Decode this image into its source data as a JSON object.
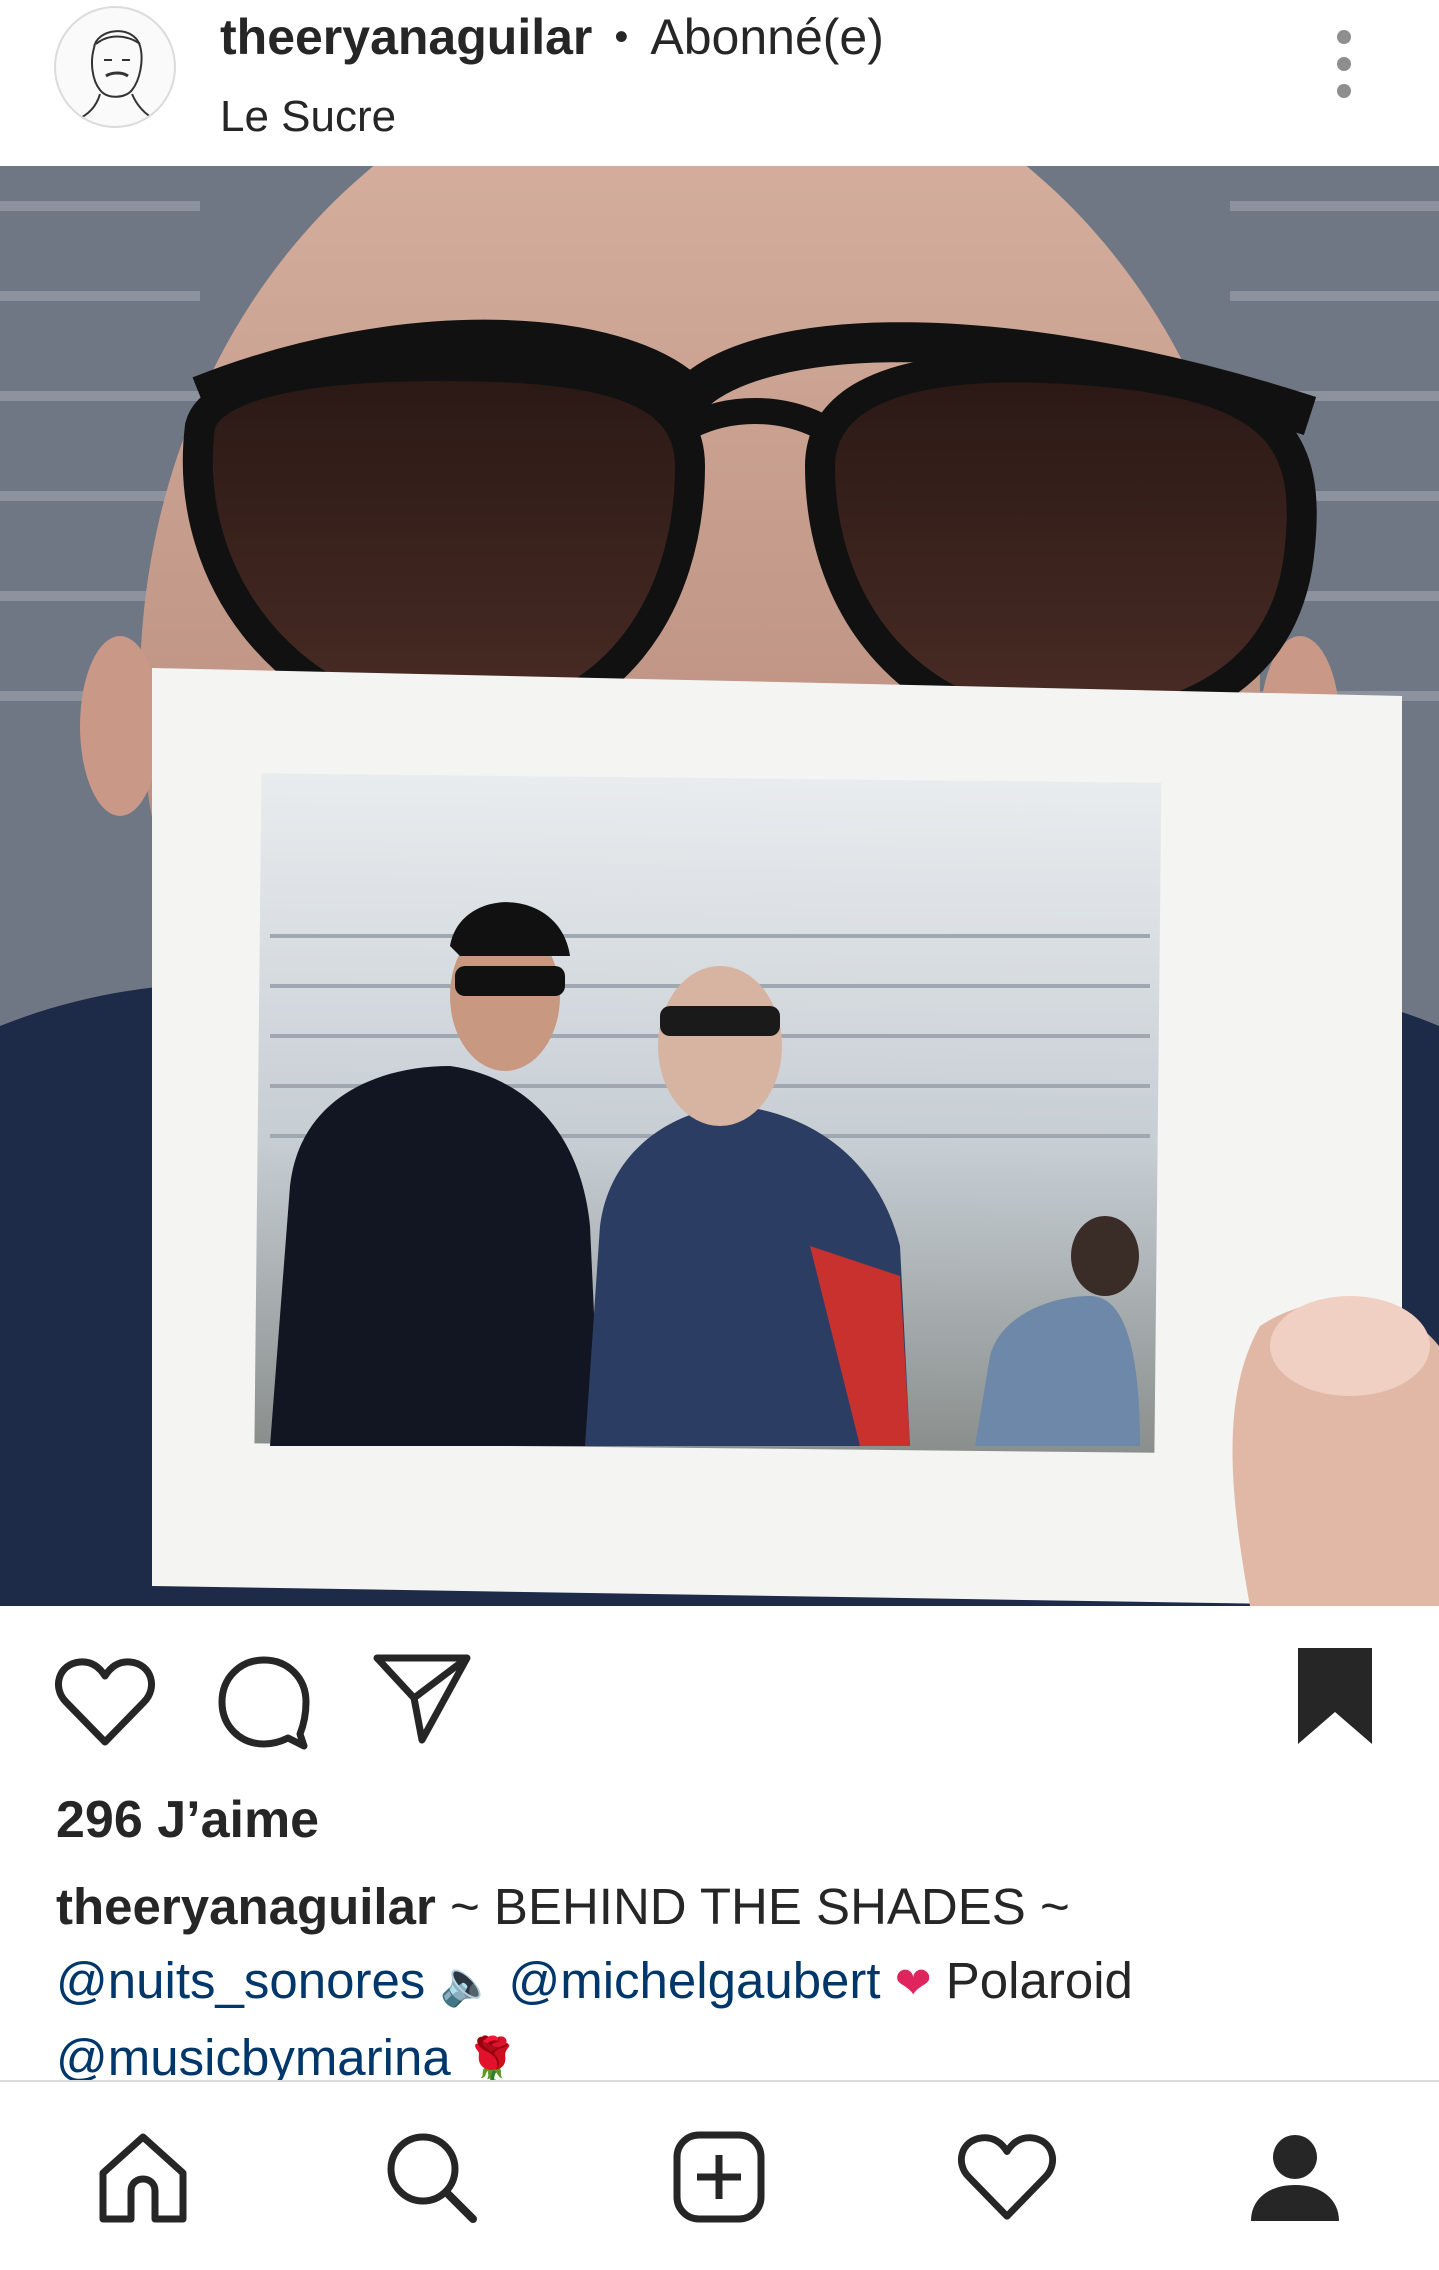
{
  "post": {
    "header": {
      "username": "theeryanaguilar",
      "separator": "•",
      "follow_status": "Abonné(e)",
      "location": "Le Sucre"
    },
    "likes_text": "296 J’aime",
    "caption": {
      "username": "theeryanaguilar",
      "text_line1": " ~ BEHIND THE SHADES ~",
      "mention1": "@nuits_sonores",
      "emoji1": "🔈",
      "mention2": "@michelgaubert",
      "emoji2": "❤",
      "text_polaroid": " Polaroid",
      "mention3": "@musicbymarina",
      "emoji3": "🌹"
    },
    "actions": {
      "like_icon": "heart-outline-icon",
      "comment_icon": "comment-bubble-icon",
      "share_icon": "paper-plane-icon",
      "save_icon": "bookmark-filled-icon"
    }
  },
  "bottom_nav": {
    "items": [
      "home-icon",
      "search-icon",
      "add-post-icon",
      "activity-heart-icon",
      "profile-icon"
    ]
  },
  "colors": {
    "text": "#262626",
    "mention": "#00376b",
    "secondary": "#8e8e8e",
    "border": "#dbdbdb"
  }
}
